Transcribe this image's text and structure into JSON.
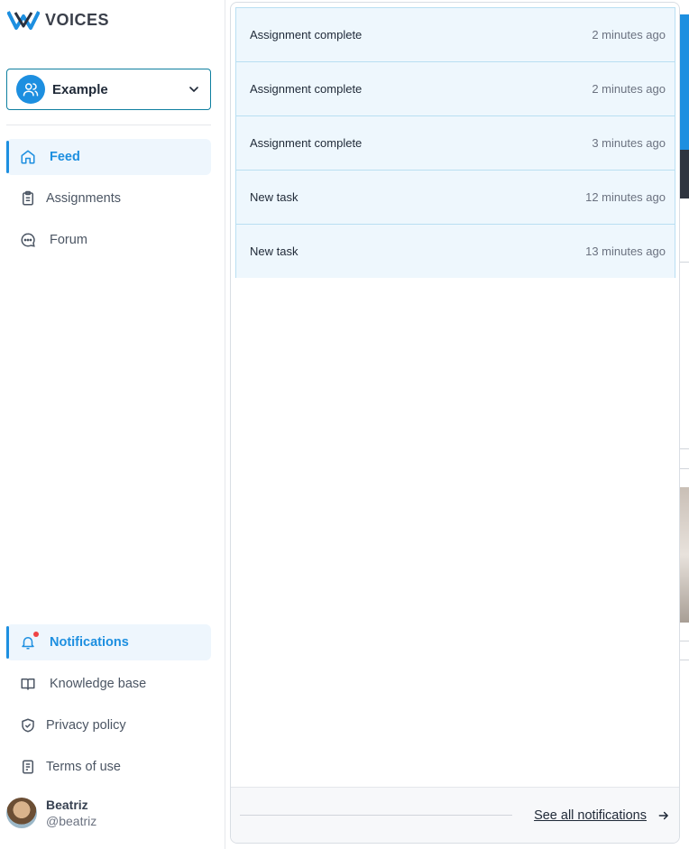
{
  "app": {
    "name": "VOICES"
  },
  "workspace": {
    "name": "Example"
  },
  "nav": {
    "top": [
      {
        "label": "Feed",
        "icon": "home-icon",
        "active": true
      },
      {
        "label": "Assignments",
        "icon": "clipboard-icon",
        "active": false
      },
      {
        "label": "Forum",
        "icon": "chat-bubble-icon",
        "active": false
      }
    ],
    "bottom": [
      {
        "label": "Notifications",
        "icon": "bell-icon",
        "active": true
      },
      {
        "label": "Knowledge base",
        "icon": "book-icon",
        "active": false
      },
      {
        "label": "Privacy policy",
        "icon": "shield-check-icon",
        "active": false
      },
      {
        "label": "Terms of use",
        "icon": "document-icon",
        "active": false
      }
    ]
  },
  "user": {
    "name": "Beatriz",
    "handle": "@beatriz"
  },
  "notifications": {
    "items": [
      {
        "title": "Assignment complete",
        "time": "2 minutes ago"
      },
      {
        "title": "Assignment complete",
        "time": "2 minutes ago"
      },
      {
        "title": "Assignment complete",
        "time": "3 minutes ago"
      },
      {
        "title": "New task",
        "time": "12 minutes ago"
      },
      {
        "title": "New task",
        "time": "13 minutes ago"
      }
    ],
    "see_all_label": "See all notifications"
  },
  "colors": {
    "accent": "#1d8fe0",
    "badge": "#ef4444",
    "row_bg": "#eef7fd"
  }
}
